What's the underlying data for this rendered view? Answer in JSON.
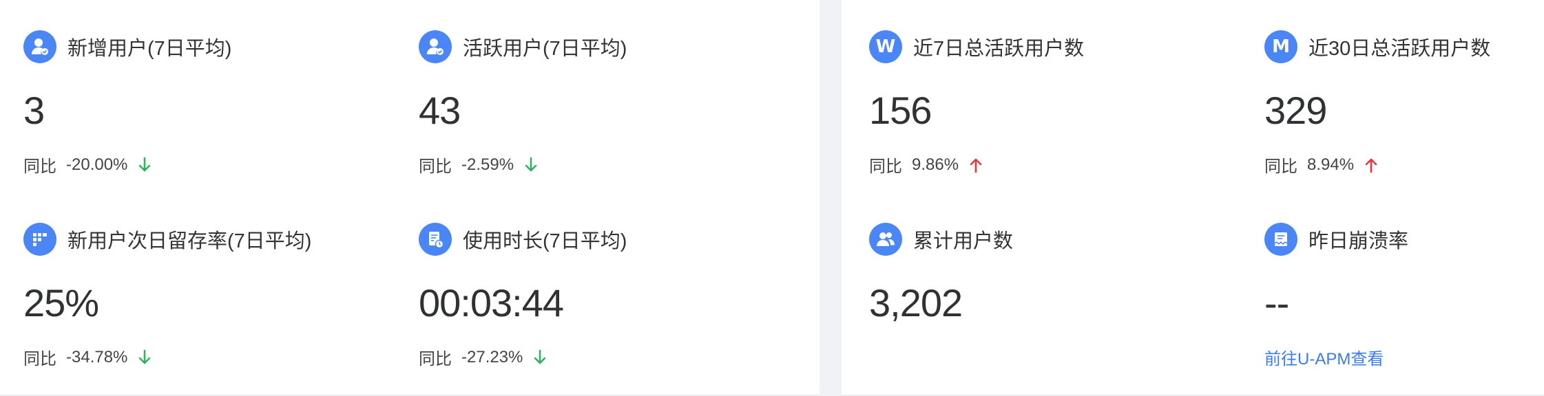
{
  "colors": {
    "accent": "#4a86f5",
    "down": "#2db55d",
    "up": "#e8363b",
    "link": "#3a7cf0"
  },
  "left_panel": {
    "cards": [
      {
        "title": "新增用户(7日平均)",
        "icon": "user-check-icon",
        "value": "3",
        "compare_label": "同比",
        "compare_value": "-20.00%",
        "trend": "down"
      },
      {
        "title": "活跃用户(7日平均)",
        "icon": "user-check-icon",
        "value": "43",
        "compare_label": "同比",
        "compare_value": "-2.59%",
        "trend": "down"
      },
      {
        "title": "新用户次日留存率(7日平均)",
        "icon": "grid-icon",
        "value": "25%",
        "compare_label": "同比",
        "compare_value": "-34.78%",
        "trend": "down"
      },
      {
        "title": "使用时长(7日平均)",
        "icon": "document-clock-icon",
        "value": "00:03:44",
        "compare_label": "同比",
        "compare_value": "-27.23%",
        "trend": "down"
      }
    ]
  },
  "right_panel": {
    "cards": [
      {
        "title": "近7日总活跃用户数",
        "icon": "letter-w-icon",
        "icon_letter": "W",
        "value": "156",
        "compare_label": "同比",
        "compare_value": "9.86%",
        "trend": "up"
      },
      {
        "title": "近30日总活跃用户数",
        "icon": "letter-m-icon",
        "icon_letter": "M",
        "value": "329",
        "compare_label": "同比",
        "compare_value": "8.94%",
        "trend": "up"
      },
      {
        "title": "累计用户数",
        "icon": "users-icon",
        "value": "3,202"
      },
      {
        "title": "昨日崩溃率",
        "icon": "crash-report-icon",
        "value": "--",
        "link_label": "前往U-APM查看"
      }
    ]
  }
}
